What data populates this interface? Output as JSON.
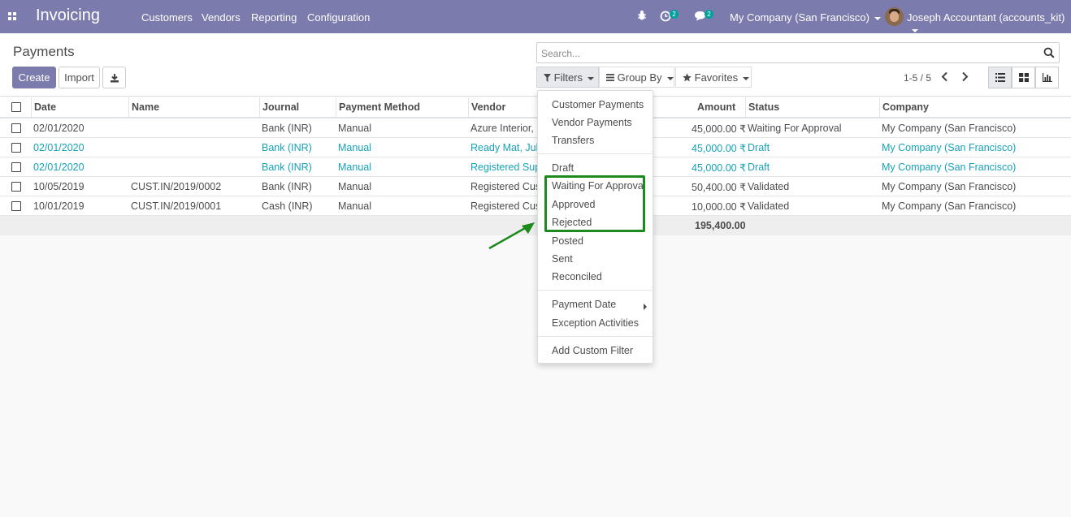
{
  "navbar": {
    "app_title": "Invoicing",
    "menu": [
      "Customers",
      "Vendors",
      "Reporting",
      "Configuration"
    ],
    "activity_count": "2",
    "message_count": "2",
    "company": "My Company (San Francisco)",
    "user": "Joseph Accountant (accounts_kit)"
  },
  "control": {
    "breadcrumb": "Payments",
    "create_label": "Create",
    "import_label": "Import",
    "search_placeholder": "Search...",
    "filters_label": "Filters",
    "groupby_label": "Group By",
    "favorites_label": "Favorites",
    "pager": "1-5 / 5"
  },
  "table": {
    "headers": [
      "Date",
      "Name",
      "Journal",
      "Payment Method",
      "Vendor",
      "Amount",
      "Status",
      "Company"
    ],
    "rows": [
      {
        "date": "02/01/2020",
        "name": "",
        "journal": "Bank (INR)",
        "method": "Manual",
        "vendor": "Azure Interior, N",
        "amount": "45,000.00 ₹",
        "status": "Waiting For Approval",
        "company": "My Company (San Francisco)"
      },
      {
        "date": "02/01/2020",
        "name": "",
        "journal": "Bank (INR)",
        "method": "Manual",
        "vendor": "Ready Mat, Juli",
        "amount": "45,000.00 ₹",
        "status": "Draft",
        "company": "My Company (San Francisco)"
      },
      {
        "date": "02/01/2020",
        "name": "",
        "journal": "Bank (INR)",
        "method": "Manual",
        "vendor": "Registered Sup",
        "amount": "45,000.00 ₹",
        "status": "Draft",
        "company": "My Company (San Francisco)"
      },
      {
        "date": "10/05/2019",
        "name": "CUST.IN/2019/0002",
        "journal": "Bank (INR)",
        "method": "Manual",
        "vendor": "Registered Cus",
        "amount": "50,400.00 ₹",
        "status": "Validated",
        "company": "My Company (San Francisco)"
      },
      {
        "date": "10/01/2019",
        "name": "CUST.IN/2019/0001",
        "journal": "Cash (INR)",
        "method": "Manual",
        "vendor": "Registered Cus",
        "amount": "10,000.00 ₹",
        "status": "Validated",
        "company": "My Company (San Francisco)"
      }
    ],
    "total": "195,400.00"
  },
  "filters_menu": {
    "group1": [
      "Customer Payments",
      "Vendor Payments",
      "Transfers"
    ],
    "group2": [
      "Draft",
      "Waiting For Approval",
      "Approved",
      "Rejected",
      "Posted",
      "Sent",
      "Reconciled"
    ],
    "group3": [
      "Payment Date",
      "Exception Activities"
    ],
    "group4": [
      "Add Custom Filter"
    ]
  },
  "colors": {
    "navbar": "#7c7bad",
    "primary": "#7c7bad",
    "draft_text": "#17a2b8",
    "highlight": "#1c8a1c",
    "badge": "#00a09d"
  }
}
